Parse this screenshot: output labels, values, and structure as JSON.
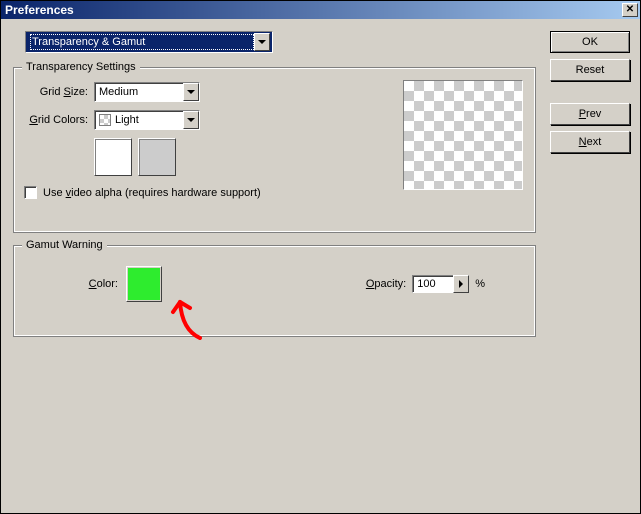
{
  "window": {
    "title": "Preferences"
  },
  "selector": {
    "value": "Transparency & Gamut"
  },
  "transparency": {
    "legend": "Transparency Settings",
    "grid_size_label": "Grid Size:",
    "grid_size_underline": "S",
    "grid_size_value": "Medium",
    "grid_colors_label": "Grid Colors:",
    "grid_colors_underline": "G",
    "grid_colors_value": "Light",
    "swatches": [
      "#ffffff",
      "#cccccc"
    ],
    "use_video_alpha_label": "Use video alpha (requires hardware support)",
    "use_video_alpha_underline": "v",
    "use_video_alpha_checked": false
  },
  "gamut": {
    "legend": "Gamut Warning",
    "color_label": "Color:",
    "color_underline": "C",
    "color_value": "#2eec2e",
    "opacity_label": "Opacity:",
    "opacity_underline": "O",
    "opacity_value": "100",
    "opacity_suffix": "%"
  },
  "buttons": {
    "ok": "OK",
    "reset": "Reset",
    "prev": "Prev",
    "next": "Next"
  },
  "annotation": {
    "type": "red-arrow",
    "points_to": "gamut-color-swatch"
  }
}
